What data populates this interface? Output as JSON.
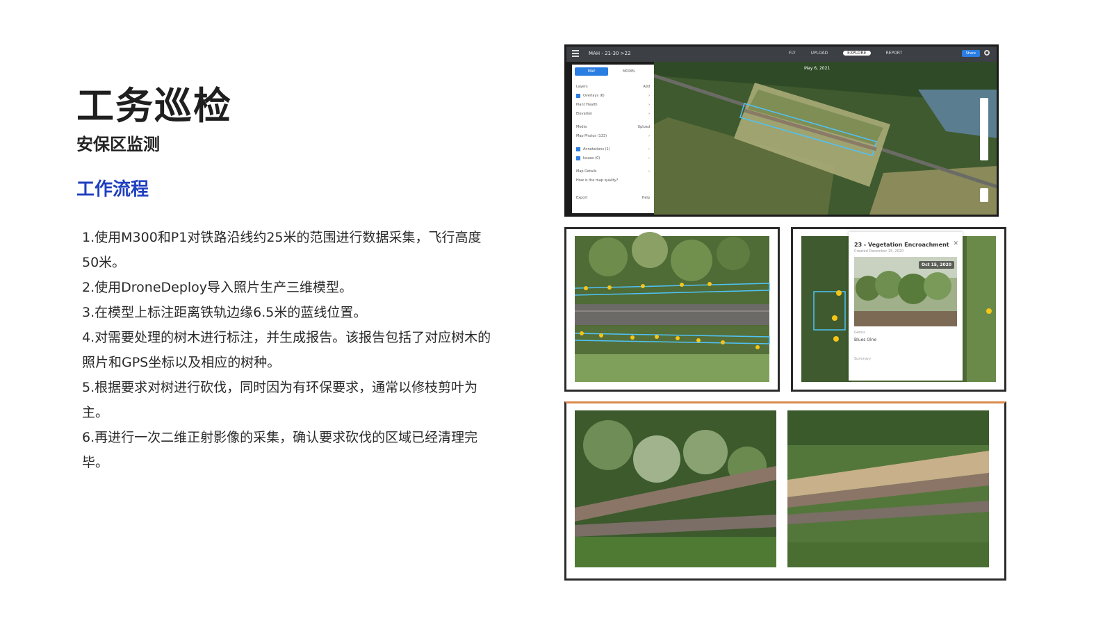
{
  "slide": {
    "title": "工务巡检",
    "subtitle": "安保区监测",
    "section_heading": "工作流程",
    "steps": [
      "1.使用M300和P1对铁路沿线约25米的范围进行数据采集，飞行高度50米。",
      "2.使用DroneDeploy导入照片生产三维模型。",
      "3.在模型上标注距离铁轨边缘6.5米的蓝线位置。",
      "4.对需要处理的树木进行标注，并生成报告。该报告包括了对应树木的照片和GPS坐标以及相应的树种。",
      "5.根据要求对树进行砍伐，同时因为有环保要求，通常以修枝剪叶为主。",
      "6.再进行一次二维正射影像的采集，确认要求砍伐的区域已经清理完毕。"
    ]
  },
  "app_screenshot": {
    "breadcrumb": "MAH - 21-30 >22",
    "nav": [
      "FLY",
      "UPLOAD",
      "EXPLORE",
      "REPORT"
    ],
    "active_nav": "EXPLORE",
    "share_label": "Share",
    "tabs": [
      "MAP",
      "MODEL"
    ],
    "date": "May 6, 2021",
    "sidebar_rows": [
      {
        "label": "Layers",
        "right": "Add"
      },
      {
        "label": "Overlays (6)",
        "right": "›",
        "checked": true
      },
      {
        "label": "Plant Health",
        "right": "›"
      },
      {
        "label": "Elevation",
        "right": "›"
      },
      {
        "label": "Media",
        "right": "Upload"
      },
      {
        "label": "Map Photos (133)",
        "right": "›"
      },
      {
        "label": "Annotations (1)",
        "right": "›",
        "checked": true
      },
      {
        "label": "Issues (0)",
        "right": "›",
        "checked": true
      },
      {
        "label": "Map Details",
        "right": "›"
      },
      {
        "label": "How is the map quality?",
        "right": ""
      },
      {
        "label": "Export",
        "right": "Help"
      }
    ]
  },
  "annotation_popup": {
    "title": "23 - Vegetation Encroachment",
    "subtitle": "Created December 15, 2020",
    "date_badge": "Oct 15, 2020",
    "field_label": "Genus",
    "field_value": "Blues Olne",
    "summary_label": "Summary"
  },
  "colors": {
    "heading_blue": "#1f3fbf",
    "annotation_line": "#4fc3f7",
    "marker": "#f5c518"
  }
}
